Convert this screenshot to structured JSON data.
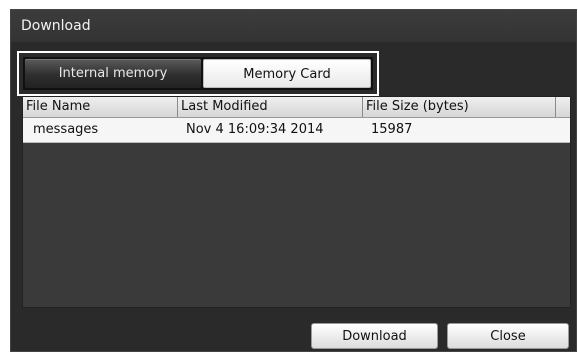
{
  "window": {
    "title": "Download"
  },
  "tabs": [
    {
      "label": "Internal memory",
      "active": true
    },
    {
      "label": "Memory Card",
      "active": false
    }
  ],
  "table": {
    "columns": [
      "File Name",
      "Last Modified",
      "File Size (bytes)"
    ],
    "rows": [
      {
        "name": "messages",
        "modified": "Nov 4 16:09:34 2014",
        "size": "15987"
      }
    ]
  },
  "buttons": {
    "download": "Download",
    "close": "Close"
  }
}
